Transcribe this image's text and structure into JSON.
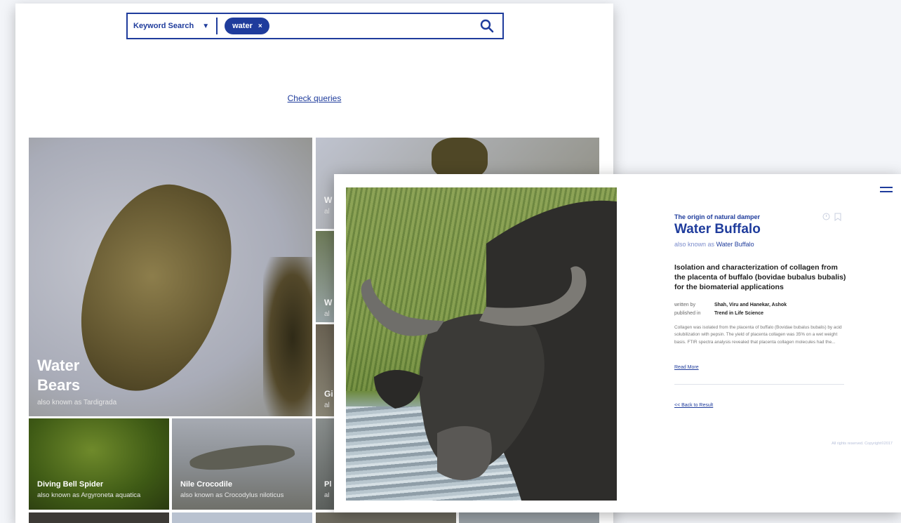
{
  "search": {
    "type_label": "Keyword Search",
    "chip_label": "water",
    "chip_remove": "×",
    "caret": "▼"
  },
  "check_queries": "Check queries",
  "tiles": {
    "water_bears": {
      "title_line1": "Water",
      "title_line2": "Bears",
      "subtitle": "also known as Tardigrada"
    },
    "peek_1": {
      "title": "W",
      "subtitle": "al"
    },
    "peek_2": {
      "title": "W",
      "subtitle": "al"
    },
    "peek_3": {
      "title": "Gi",
      "subtitle": "al"
    },
    "peek_4": {
      "title": "Pl",
      "subtitle": "al"
    },
    "diving_bell_spider": {
      "title": "Diving Bell Spider",
      "subtitle": "also known as Argyroneta aquatica"
    },
    "nile_crocodile": {
      "title": "Nile Crocodile",
      "subtitle": "also known as Crocodylus niloticus"
    }
  },
  "detail": {
    "eyebrow": "The origin of natural damper",
    "title": "Water Buffalo",
    "aka_prefix": "also known as",
    "aka_name": "Water Buffalo",
    "paper_title": "Isolation and characterization of collagen from the placenta of buffalo (bovidae bubalus bubalis) for the biomaterial applications",
    "written_by_label": "written by",
    "written_by": "Shah, Viru and Hanekar, Ashok",
    "published_in_label": "published in",
    "published_in": "Trend in Life Science",
    "abstract": "Collagen was isolated from the placenta of buffalo (Bovidae bubalus bubalis) by acid solubilization with pepsin. The yield of placenta collagen was 35% on a wet weight basis. FTIR spectra analysis revealed that placenta collagen molecules had the...",
    "read_more": "Read More",
    "back": "<< Back to Result",
    "copyright": "All rights reserved. Copyright©2017"
  },
  "colors": {
    "accent": "#1f3c9c",
    "muted_accent": "#7b8ccc"
  },
  "icons": [
    "search-icon",
    "menu-icon",
    "clock-icon",
    "bookmark-icon"
  ]
}
